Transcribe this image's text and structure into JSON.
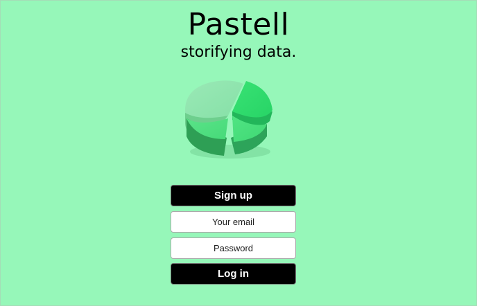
{
  "brand": {
    "title": "Pastell",
    "tagline": "storifying data."
  },
  "logo": {
    "icon": "pie-chart-icon",
    "colors": [
      "#8fe6ad",
      "#2fdc6e",
      "#4ee07f",
      "#44dd78"
    ]
  },
  "auth": {
    "signup_label": "Sign up",
    "email_placeholder": "Your email",
    "email_value": "",
    "password_placeholder": "Password",
    "password_value": "",
    "login_label": "Log in"
  },
  "colors": {
    "background": "#96f7b9",
    "button": "#000000"
  }
}
